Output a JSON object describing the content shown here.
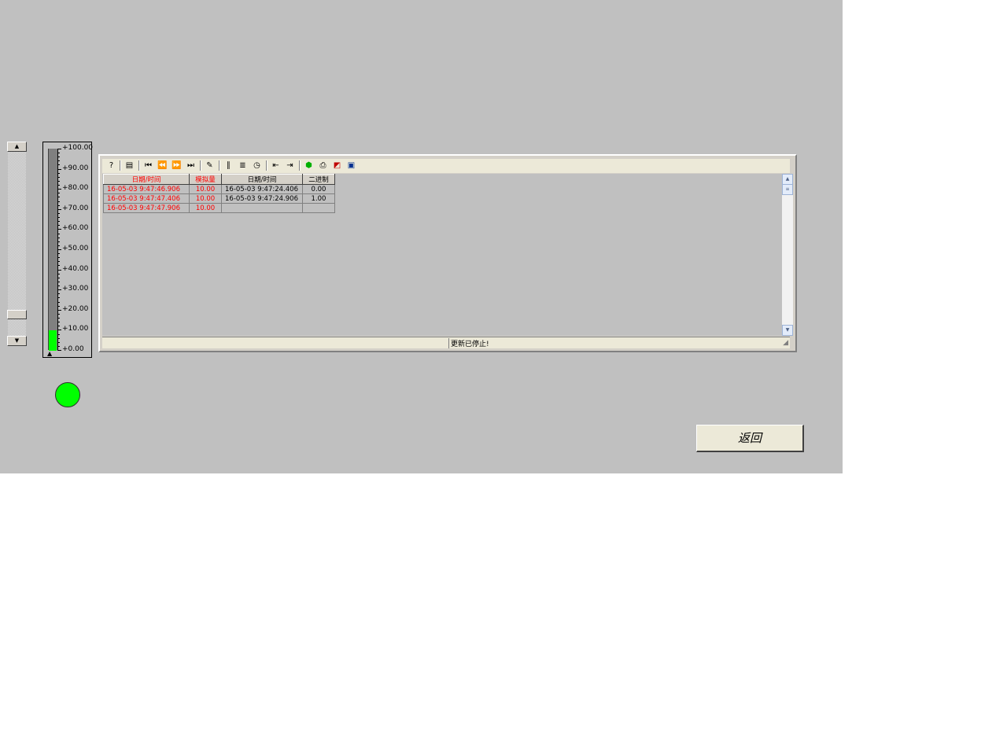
{
  "gauge": {
    "ticks": [
      "+100.00",
      "+90.00",
      "+80.00",
      "+70.00",
      "+60.00",
      "+50.00",
      "+40.00",
      "+30.00",
      "+20.00",
      "+10.00",
      "+0.00"
    ],
    "value": 10.0,
    "max": 100.0,
    "fill_color": "#00ff00"
  },
  "lamp": {
    "state": "on",
    "color": "#00ff00"
  },
  "toolbar": {
    "icons": [
      "help-icon",
      "keyboard-icon",
      "first-icon",
      "previous-icon",
      "next-icon",
      "last-icon",
      "edit-icon",
      "columns-icon",
      "list-icon",
      "timer-icon",
      "import-icon",
      "export-icon",
      "stop-icon",
      "print-icon",
      "chart-icon",
      "properties-icon"
    ]
  },
  "table": {
    "headers": [
      "日期/时间",
      "模拟量",
      "日期/时间",
      "二进制"
    ],
    "header_colors": [
      "#ff0000",
      "#ff0000",
      "#000000",
      "#000000"
    ],
    "rows": [
      [
        "16-05-03 9:47:46.906",
        "10.00",
        "16-05-03 9:47:24.406",
        "0.00"
      ],
      [
        "16-05-03 9:47:47.406",
        "10.00",
        "16-05-03 9:47:24.906",
        "1.00"
      ],
      [
        "16-05-03 9:47:47.906",
        "10.00",
        "",
        ""
      ]
    ],
    "red_color": "#ff0000"
  },
  "status": {
    "text": "更新已停止!"
  },
  "return_button": {
    "label": "返回"
  }
}
